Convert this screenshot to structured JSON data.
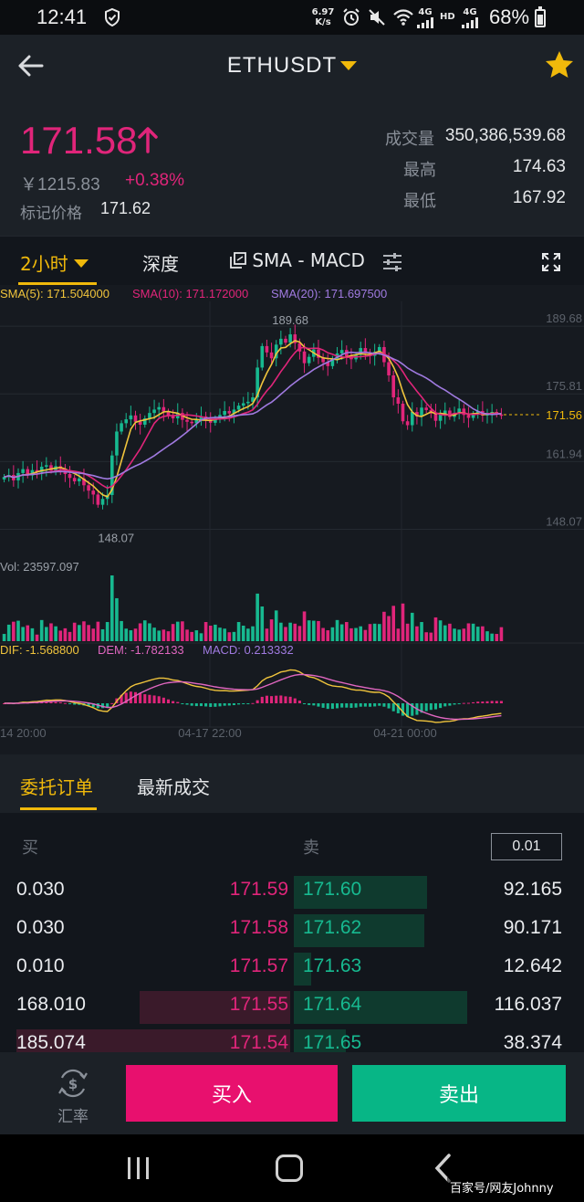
{
  "status_bar": {
    "time": "12:41",
    "speed": "6.97",
    "speed_unit": "K/s",
    "network_1": "4G",
    "network_2": "HD",
    "network_3": "4G",
    "battery": "68%"
  },
  "header": {
    "title": "ETHUSDT",
    "back_icon": "back-arrow-icon",
    "favorite_icon": "star-icon"
  },
  "ticker": {
    "last_price": "171.58",
    "price_direction": "up",
    "cny_price": "￥1215.83",
    "change_percent": "+0.38%",
    "mark_price_label": "标记价格",
    "mark_price": "171.62",
    "volume_label": "成交量",
    "volume": "350,386,539.68",
    "high_label": "最高",
    "high": "174.63",
    "low_label": "最低",
    "low": "167.92"
  },
  "chart_tabs": {
    "interval": "2小时",
    "depth": "深度",
    "indicators": "SMA - MACD",
    "settings_icon": "sliders-icon",
    "fullscreen_icon": "fullscreen-icon"
  },
  "chart_data": {
    "type": "candlestick",
    "symbol": "ETHUSDT",
    "interval": "2h",
    "ma_legend": {
      "sma5": "SMA(5): 171.504000",
      "sma10": "SMA(10): 171.172000",
      "sma20": "SMA(20): 171.697500"
    },
    "y_ticks": [
      "189.68",
      "175.81",
      "161.94",
      "148.07"
    ],
    "ylim": [
      142,
      194
    ],
    "current_price_label": "171.56",
    "high_marker": "189.68",
    "low_marker": "148.07",
    "volume_label": "Vol: 23597.097",
    "macd_legend": {
      "dif": "DIF: -1.568800",
      "dem": "DEM: -1.782133",
      "macd": "MACD: 0.213332"
    },
    "x_ticks": [
      "14 20:00",
      "04-17 22:00",
      "04-21 00:00"
    ],
    "colors": {
      "up": "#17b990",
      "down": "#e0257a",
      "sma5": "#f0c43c",
      "sma10": "#e0257a",
      "sma20": "#a07ae0",
      "dif": "#f0c43c",
      "dem": "#e066c0"
    },
    "close": [
      158.8,
      159.2,
      158.1,
      159.6,
      160.4,
      159.1,
      160.2,
      159.8,
      160.9,
      161.2,
      160.1,
      161.0,
      160.5,
      159.4,
      158.6,
      157.9,
      158.5,
      157.1,
      156.0,
      155.2,
      153.1,
      154.3,
      155.1,
      163.2,
      168.1,
      169.8,
      170.6,
      171.4,
      170.1,
      169.5,
      170.8,
      171.9,
      172.6,
      173.1,
      172.2,
      171.3,
      170.8,
      171.9,
      170.5,
      170.1,
      169.8,
      170.6,
      171.2,
      170.4,
      169.9,
      170.8,
      171.5,
      172.3,
      171.8,
      172.6,
      173.4,
      173.9,
      174.2,
      175.1,
      181.2,
      185.6,
      184.3,
      183.1,
      185.9,
      187.1,
      186.3,
      188.0,
      186.2,
      184.5,
      182.1,
      183.4,
      184.9,
      183.2,
      182.3,
      181.5,
      183.0,
      184.1,
      184.8,
      183.5,
      182.9,
      183.8,
      185.2,
      184.1,
      183.6,
      184.4,
      185.4,
      182.3,
      179.6,
      175.1,
      173.8,
      170.2,
      169.4,
      172.1,
      171.2,
      173.0,
      172.5,
      171.8,
      170.3,
      171.6,
      172.4,
      171.1,
      171.9,
      172.8,
      171.5,
      170.9,
      171.7,
      172.3,
      171.4,
      171.8,
      172.1,
      171.6,
      171.58
    ]
  },
  "orderbook": {
    "tab_orders": "委托订单",
    "tab_trades": "最新成交",
    "bid_header": "买",
    "ask_header": "卖",
    "precision": "0.01",
    "rows": [
      {
        "bid_amount": "0.030",
        "bid_price": "171.59",
        "ask_price": "171.60",
        "ask_amount": "92.165",
        "bid_depth": 0.0,
        "ask_depth": 0.77
      },
      {
        "bid_amount": "0.030",
        "bid_price": "171.58",
        "ask_price": "171.62",
        "ask_amount": "90.171",
        "bid_depth": 0.0,
        "ask_depth": 0.75
      },
      {
        "bid_amount": "0.010",
        "bid_price": "171.57",
        "ask_price": "171.63",
        "ask_amount": "12.642",
        "bid_depth": 0.0,
        "ask_depth": 0.1
      },
      {
        "bid_amount": "168.010",
        "bid_price": "171.55",
        "ask_price": "171.64",
        "ask_amount": "116.037",
        "bid_depth": 0.55,
        "ask_depth": 1.0
      },
      {
        "bid_amount": "185.074",
        "bid_price": "171.54",
        "ask_price": "171.65",
        "ask_amount": "38.374",
        "bid_depth": 1.0,
        "ask_depth": 0.3
      }
    ]
  },
  "actions": {
    "rate_label": "汇率",
    "buy": "买入",
    "sell": "卖出"
  },
  "watermark": "百家号/网友Johnny"
}
